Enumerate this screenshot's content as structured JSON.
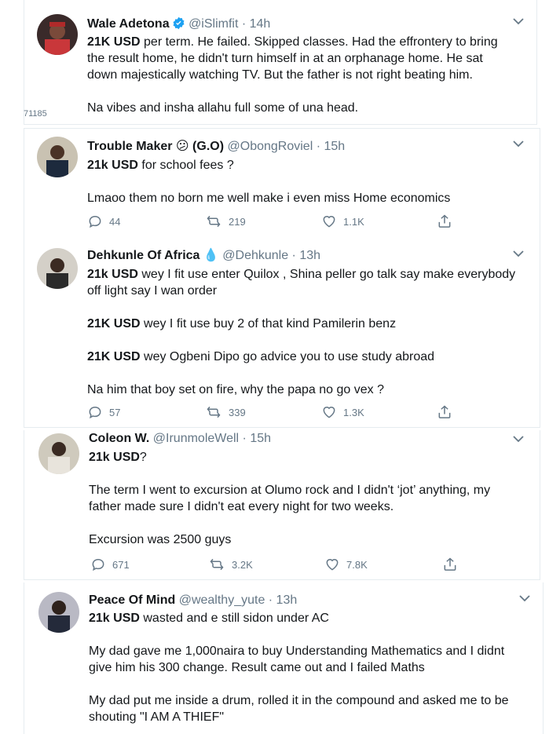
{
  "side_label": "71185",
  "tweets": [
    {
      "name": "Wale Adetona",
      "handle": "@iSlimfit · 14h",
      "verified": true,
      "lines": [
        {
          "bold": "21K USD",
          "text": " per term. He failed. Skipped classes. Had the effrontery to bring"
        },
        {
          "bold": "",
          "text": "the result home, he didn't turn himself in at an orphanage home. He sat"
        },
        {
          "bold": "",
          "text": "down majestically watching TV. But the father is not right beating him."
        },
        {
          "bold": "",
          "text": ""
        },
        {
          "bold": "",
          "text": "Na vibes and insha allahu full some of una head."
        }
      ]
    },
    {
      "name": "Trouble Maker 😕 (G.O)",
      "handle": "@ObongRoviel · 15h",
      "lines": [
        {
          "bold": "21k USD",
          "text": " for school fees ?"
        },
        {
          "bold": "",
          "text": ""
        },
        {
          "bold": "",
          "text": "Lmaoo them no born me well make i even miss Home economics"
        }
      ],
      "replies": "44",
      "retweets": "219",
      "likes": "1.1K"
    },
    {
      "name": "Dehkunle Of Africa 💧",
      "handle": "@Dehkunle · 13h",
      "lines": [
        {
          "bold": "21k USD",
          "text": " wey I fit use enter Quilox , Shina peller go talk say make everybody"
        },
        {
          "bold": "",
          "text": "off light say I wan order"
        },
        {
          "bold": "",
          "text": ""
        },
        {
          "bold": "21K  USD",
          "text": " wey I fit use buy 2 of that kind Pamilerin benz"
        },
        {
          "bold": "",
          "text": ""
        },
        {
          "bold": "21K USD",
          "text": " wey Ogbeni Dipo go advice you to use study abroad"
        },
        {
          "bold": "",
          "text": ""
        },
        {
          "bold": "",
          "text": "Na him that boy set on fire, why the papa no go vex ?"
        }
      ],
      "replies": "57",
      "retweets": "339",
      "likes": "1.3K"
    },
    {
      "name": "Coleon W.",
      "handle": "@IrunmoleWell · 15h",
      "lines": [
        {
          "bold": "21k USD",
          "text": "?"
        },
        {
          "bold": "",
          "text": ""
        },
        {
          "bold": "",
          "text": "The term I went to excursion at Olumo rock and I didn't ‘jot’ anything,  my"
        },
        {
          "bold": "",
          "text": "father made sure I didn't eat every night for two weeks."
        },
        {
          "bold": "",
          "text": ""
        },
        {
          "bold": "",
          "text": "Excursion was 2500 guys"
        }
      ],
      "replies": "671",
      "retweets": "3.2K",
      "likes": "7.8K"
    },
    {
      "name": "Peace Of Mind",
      "handle": "@wealthy_yute · 13h",
      "lines": [
        {
          "bold": "21k USD",
          "text": " wasted and e still sidon under AC"
        },
        {
          "bold": "",
          "text": ""
        },
        {
          "bold": "",
          "text": "My dad gave me 1,000naira to buy Understanding Mathematics and I didnt"
        },
        {
          "bold": "",
          "text": "give him his 300 change. Result came out and I failed Maths"
        },
        {
          "bold": "",
          "text": ""
        },
        {
          "bold": "",
          "text": "My dad put me inside a drum, rolled it in the compound and asked me to be"
        },
        {
          "bold": "",
          "text": "shouting \"I AM A THIEF\""
        }
      ]
    }
  ],
  "colors": {
    "text": "#14171a",
    "muted": "#657786",
    "verified": "#1da1f2",
    "border": "#e6ecf0"
  }
}
